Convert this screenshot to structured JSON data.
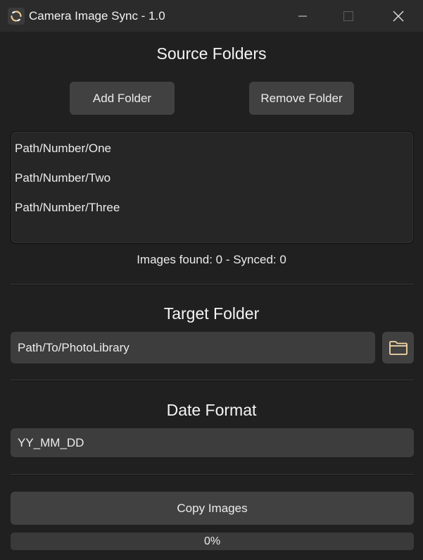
{
  "window": {
    "title": "Camera Image Sync - 1.0",
    "icon": "sync-icon"
  },
  "source": {
    "heading": "Source Folders",
    "add_label": "Add Folder",
    "remove_label": "Remove Folder",
    "folders": [
      "Path/Number/One",
      "Path/Number/Two",
      "Path/Number/Three"
    ],
    "status": "Images found: 0 - Synced: 0"
  },
  "target": {
    "heading": "Target Folder",
    "path": "Path/To/PhotoLibrary",
    "browse_icon": "folder-icon"
  },
  "date": {
    "heading": "Date Format",
    "value": "YY_MM_DD"
  },
  "actions": {
    "copy_label": "Copy Images"
  },
  "progress": {
    "value": 0,
    "label": "0%"
  },
  "colors": {
    "background": "#202020",
    "titlebar": "#2b2b2b",
    "button": "#414141",
    "accent_folder": "#f5d7a6"
  }
}
